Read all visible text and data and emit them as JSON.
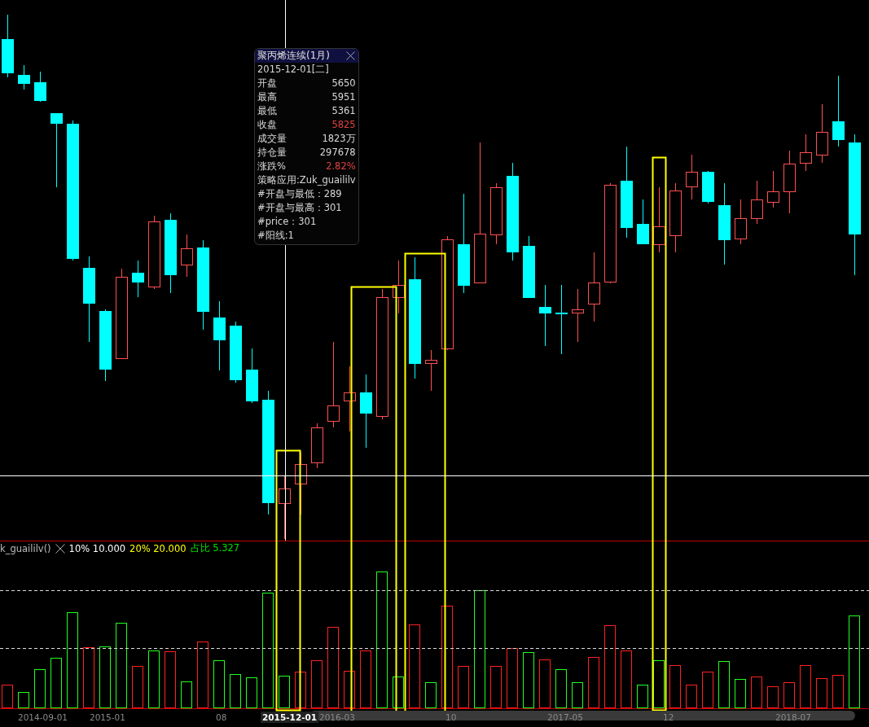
{
  "tooltip": {
    "title": "聚丙烯连续(1月)",
    "date": "2015-12-01[二]",
    "rows": [
      {
        "label": "开盘",
        "value": "5650",
        "color": "#d8d8d8"
      },
      {
        "label": "最高",
        "value": "5951",
        "color": "#d8d8d8"
      },
      {
        "label": "最低",
        "value": "5361",
        "color": "#d8d8d8"
      },
      {
        "label": "收盘",
        "value": "5825",
        "color": "#e04040"
      },
      {
        "label": "成交量",
        "value": "1823万",
        "color": "#d8d8d8"
      },
      {
        "label": "持仓量",
        "value": "297678",
        "color": "#d8d8d8"
      },
      {
        "label": "涨跌%",
        "value": "2.82%",
        "color": "#e04040"
      }
    ],
    "notes": [
      "策略应用:Zuk_guaililv",
      "#开盘与最低：289",
      "#开盘与最高：301",
      "#price：301",
      "#阳线:1"
    ]
  },
  "indicator": {
    "name": "k_guaililv()",
    "items": [
      {
        "label": "10%",
        "value": "10.000",
        "color": "#ffffff"
      },
      {
        "label": "20%",
        "value": "20.000",
        "color": "#ffff00"
      },
      {
        "label": "占比",
        "value": "5.327",
        "color": "#00e000"
      }
    ]
  },
  "time_axis": [
    {
      "label": "2014-09-01",
      "selected": false
    },
    {
      "label": "2015-01",
      "selected": false
    },
    {
      "label": "08",
      "selected": false
    },
    {
      "label": "2015-12-01",
      "selected": true
    },
    {
      "label": "2016-03",
      "selected": false
    },
    {
      "label": "10",
      "selected": false
    },
    {
      "label": "2017-05",
      "selected": false
    },
    {
      "label": "12",
      "selected": false
    },
    {
      "label": "2018-07",
      "selected": false
    }
  ]
}
